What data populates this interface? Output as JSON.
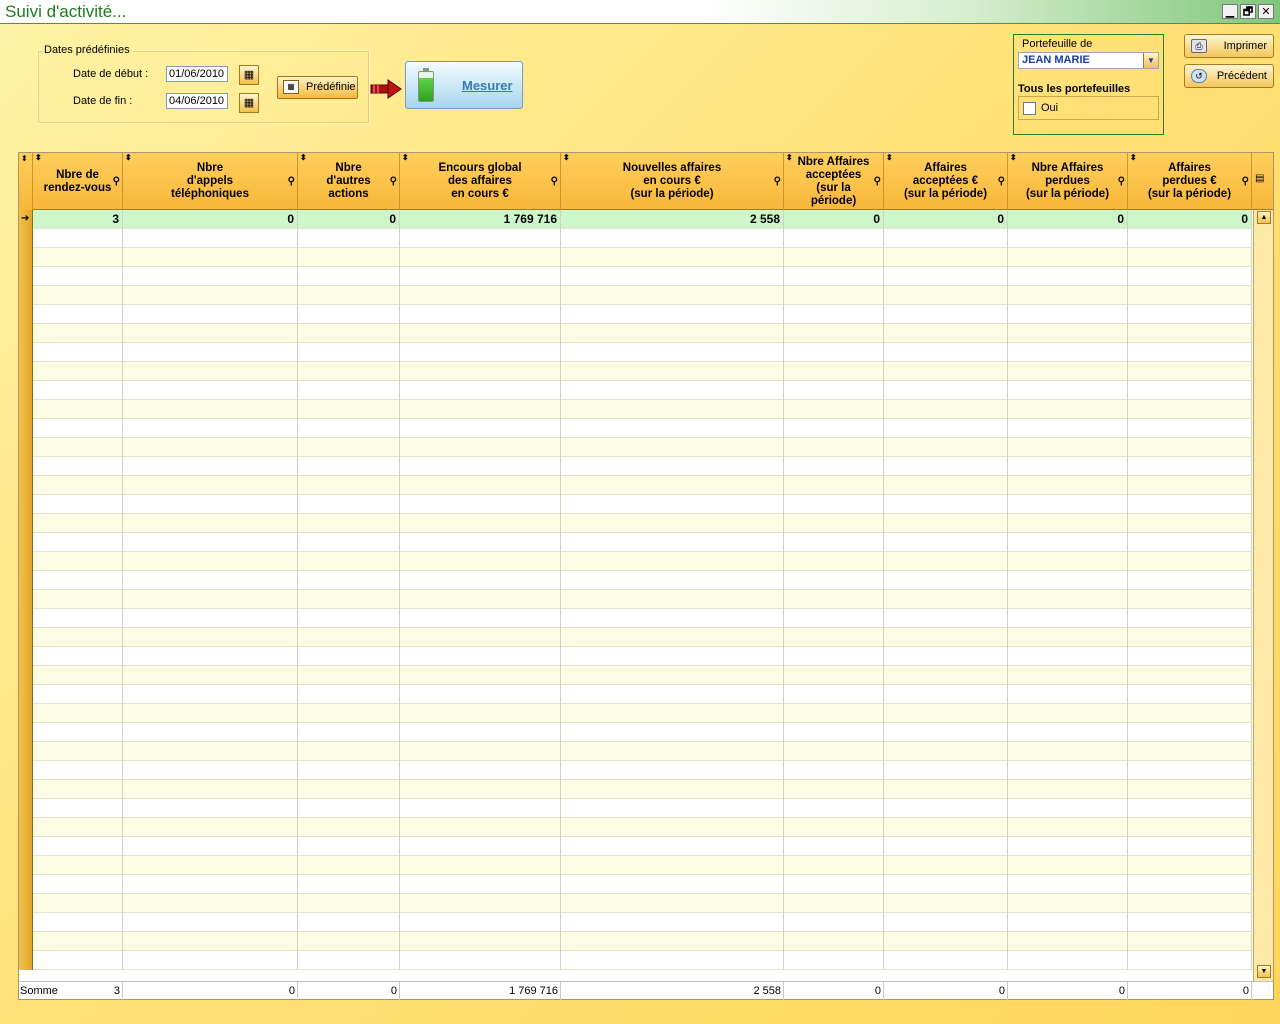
{
  "window": {
    "title": "Suivi d'activité...",
    "buttons": [
      "▁",
      "🗗",
      "✕"
    ]
  },
  "dates": {
    "group_label": "Dates prédéfinies",
    "start_label": "Date de début :",
    "start_value": "01/06/2010",
    "end_label": "Date de fin :",
    "end_value": "04/06/2010",
    "predef_label": "Prédéfinie"
  },
  "measure": {
    "label": "Mesurer"
  },
  "portfolio": {
    "label": "Portefeuille de",
    "selected": "JEAN MARIE",
    "all_label": "Tous les portefeuilles",
    "checkbox_label": "Oui",
    "checked": false
  },
  "side_buttons": {
    "print": "Imprimer",
    "back": "Précédent"
  },
  "table": {
    "columns": [
      "Nbre de\nrendez-vous",
      "Nbre\nd'appels\ntéléphoniques",
      "Nbre\nd'autres\nactions",
      "Encours global\ndes affaires\nen cours €",
      "Nouvelles affaires\nen cours €\n(sur la période)",
      "Nbre Affaires\nacceptées\n(sur la période)",
      "Affaires\nacceptées €\n(sur la période)",
      "Nbre Affaires\nperdues\n(sur la période)",
      "Affaires\nperdues €\n(sur la période)"
    ],
    "rows": [
      [
        "3",
        "0",
        "0",
        "1 769 716",
        "2 558",
        "0",
        "0",
        "0",
        "0"
      ]
    ],
    "footer_label": "Somme",
    "totals": [
      "3",
      "0",
      "0",
      "1 769 716",
      "2 558",
      "0",
      "0",
      "0",
      "0"
    ]
  },
  "colors": {
    "accent": "#f7b73a",
    "selected_row": "#cdf7cb",
    "title_text": "#1e7a1e"
  }
}
